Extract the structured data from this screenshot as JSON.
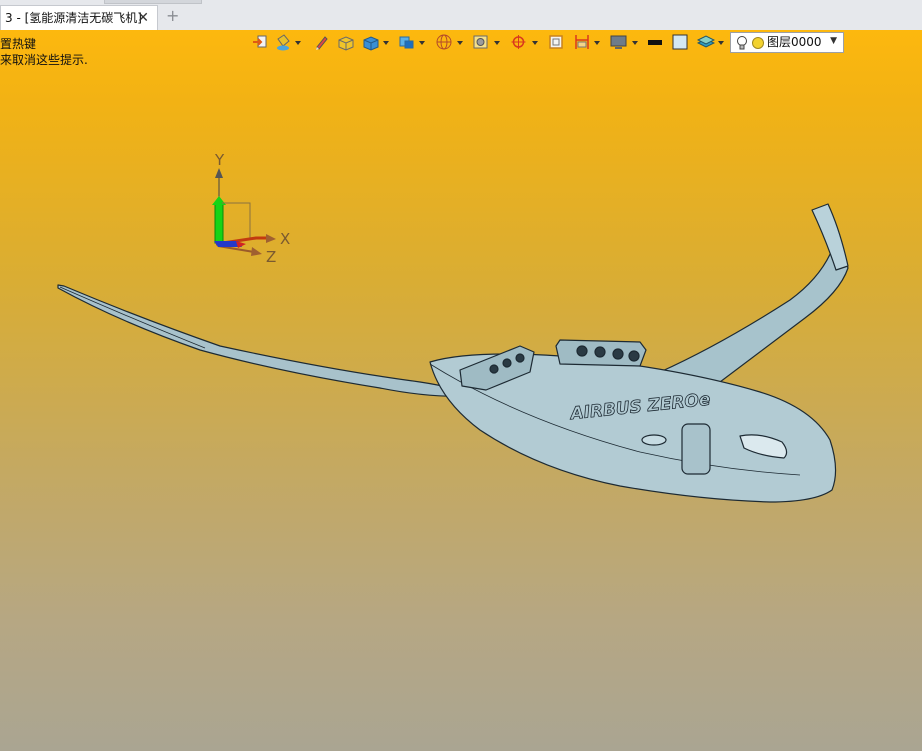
{
  "window": {
    "tab_title": "3 - [氢能源清洁无碳飞机]",
    "tab_close_icon": "close-icon",
    "new_tab_icon": "plus-icon"
  },
  "hints": {
    "line1": "置热键",
    "line2": "来取消这些提示."
  },
  "toolbar": {
    "icons": [
      "import-icon",
      "paint-bucket-icon",
      "pencil-icon",
      "solid-box-icon",
      "cube-icon",
      "view-cube-icon",
      "sphere-wireframe-icon",
      "render-icon",
      "snap-target-icon",
      "frame-icon",
      "section-icon",
      "display-icon",
      "color-black-icon",
      "color-fill-icon",
      "layers-icon"
    ],
    "layer": {
      "bulb_icon": "lightbulb-icon",
      "dot_icon": "layer-dot-icon",
      "selected_value": "图层0000"
    }
  },
  "triad": {
    "y_label": "Y",
    "x_label": "X",
    "z_label": "Z"
  },
  "model": {
    "fuselage_text": "AIRBUS ZEROe"
  }
}
